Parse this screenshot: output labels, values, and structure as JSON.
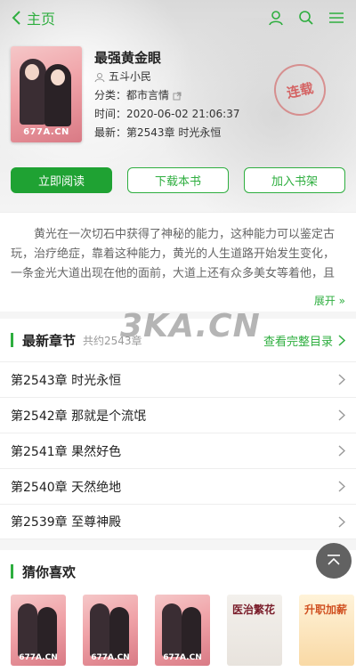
{
  "header": {
    "back_label": "主页"
  },
  "book": {
    "title": "最强黄金眼",
    "author": "五斗小民",
    "category_label": "分类：",
    "category": "都市言情",
    "time_label": "时间：",
    "time": "2020-06-02 21:06:37",
    "latest_label": "最新：",
    "latest": "第2543章 时光永恒",
    "cover_watermark": "677A.CN",
    "status_stamp": "连载"
  },
  "actions": {
    "read": "立即阅读",
    "download": "下载本书",
    "shelf": "加入书架"
  },
  "description": {
    "text": "黄光在一次切石中获得了神秘的能力，这种能力可以鉴定古玩，治疗绝症，靠着这种能力，黄光的人生道路开始发生变化，一条金光大道出现在他的面前，大道上还有众多美女等着他，且",
    "expand_label": "展开"
  },
  "site_watermark": "3KA.CN",
  "latest_chapters": {
    "heading": "最新章节",
    "sub": "共约2543章",
    "more": "查看完整目录",
    "items": [
      "第2543章 时光永恒",
      "第2542章 那就是个流氓",
      "第2541章 果然好色",
      "第2540章 天然绝地",
      "第2539章 至尊神殿"
    ]
  },
  "recommend": {
    "heading": "猜你喜欢",
    "covers": [
      {
        "wm": "677A.CN"
      },
      {
        "wm": "677A.CN"
      },
      {
        "wm": "677A.CN"
      },
      {
        "title": "医治繁花"
      },
      {
        "title": "升职加薪"
      }
    ]
  },
  "colors": {
    "accent": "#2eae3f",
    "primary_button": "#1fa233"
  },
  "icons": [
    "chevron-left-icon",
    "user-icon",
    "search-icon",
    "menu-icon",
    "author-icon",
    "external-link-icon",
    "chevron-right-icon",
    "back-to-top-icon"
  ]
}
